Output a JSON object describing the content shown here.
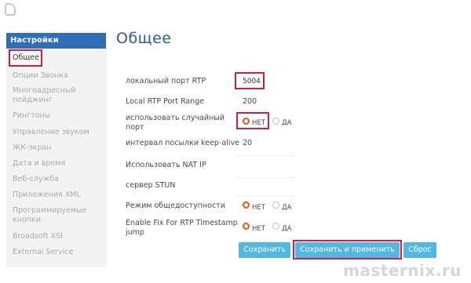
{
  "sidebar": {
    "header": "Настройки",
    "active": "Общее",
    "items": [
      "Опции Звонка",
      "Многоадресный пейджинг",
      "Рингтоны",
      "Управление звуком",
      "ЖК-экран",
      "Дата и время",
      "Веб-служба",
      "Приложения XML",
      "Программируемые кнопки",
      "Broadsoft XSI",
      "External Service"
    ]
  },
  "main": {
    "title": "Общее",
    "fields": {
      "local_port_label": "локальный порт RTP",
      "local_port_value": "5004",
      "range_label": "Local RTP Port Range",
      "range_value": "200",
      "random_label": "использовать случайный порт",
      "interval_label": "интервал посылки keep-alive",
      "interval_value": "20",
      "nat_label": "Использовать NAT IP",
      "stun_label": "сервер STUN",
      "public_label": "Режим общедоступности",
      "fix_label": "Enable Fix For RTP Timestamp jump"
    },
    "radio": {
      "no": "НЕТ",
      "yes": "ДА"
    },
    "buttons": {
      "save": "Сохранить",
      "save_apply": "Сохранить и применить",
      "reset": "Сброс"
    }
  },
  "watermark": "masternix.ru"
}
